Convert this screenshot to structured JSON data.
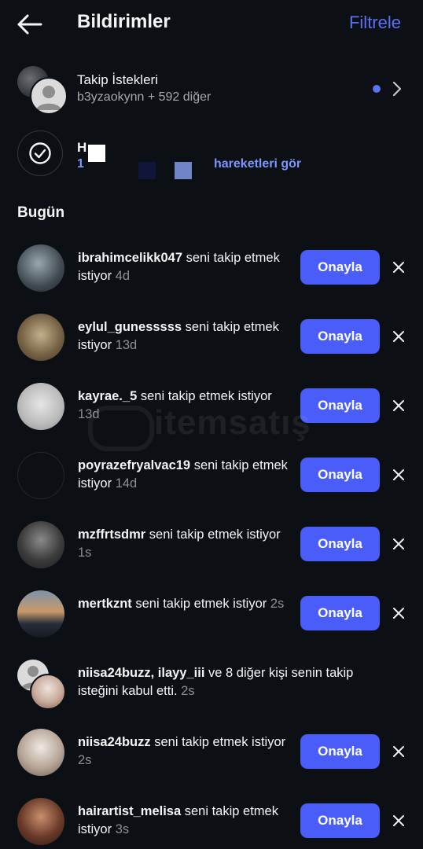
{
  "header": {
    "title": "Bildirimler",
    "filter_label": "Filtrele"
  },
  "follow_requests": {
    "title": "Takip İstekleri",
    "subtitle": "b3yzaokynn + 592 diğer"
  },
  "activity": {
    "heading_partial": "H",
    "link_number_partial": "1",
    "link_text_partial": "hareketleri gör"
  },
  "section_title": "Bugün",
  "approve_label": "Onayla",
  "rows": [
    {
      "username": "ibrahimcelikk047",
      "message": "seni takip etmek istiyor",
      "time": "4d",
      "avatar_color": "#5a6a72"
    },
    {
      "username": "eylul_gunesssss",
      "message": "seni takip etmek istiyor",
      "time": "13d",
      "avatar_color": "#8a7a5e"
    },
    {
      "username": "kayrae._5",
      "message": "seni takip etmek istiyor",
      "time": "13d",
      "avatar_color": "#c9c9c9"
    },
    {
      "username": "poyrazefryalvac19",
      "message": "seni takip etmek istiyor",
      "time": "14d",
      "avatar_color": "#0c1014"
    },
    {
      "username": "mzffrtsdmr",
      "message": "seni takip etmek istiyor",
      "time": "1s",
      "avatar_color": "#3b3b3b"
    },
    {
      "username": "mertkznt",
      "message": "seni takip etmek istiyor",
      "time": "2s",
      "avatar_color": "#4f6b86"
    },
    {
      "username": "niisa24buzz",
      "message": "seni takip etmek istiyor",
      "time": "2s",
      "avatar_color": "#b9a89b"
    },
    {
      "username": "hairartist_melisa",
      "message": "seni takip etmek istiyor",
      "time": "3s",
      "avatar_color": "#6a3a2a"
    }
  ],
  "accepted": {
    "users": "niisa24buzz, ilayy_iii",
    "message": "ve 8 diğer kişi senin takip isteğini kabul etti.",
    "time": "2s"
  },
  "watermark": "itemsatış",
  "colors": {
    "accent": "#4a5df9",
    "link": "#5b72f2",
    "background": "#0c1014"
  }
}
